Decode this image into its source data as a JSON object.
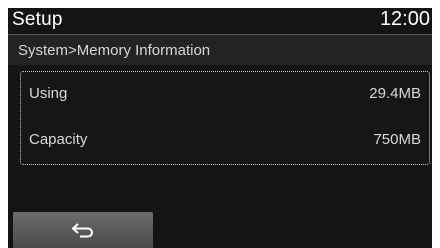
{
  "header": {
    "title": "Setup",
    "clock": "12:00"
  },
  "breadcrumb": "System>Memory Information",
  "memory": {
    "rows": [
      {
        "label": "Using",
        "value": "29.4MB"
      },
      {
        "label": "Capacity",
        "value": "750MB"
      }
    ]
  },
  "footer": {
    "back_icon": "back-arrow-icon"
  },
  "colors": {
    "screen_bg": "#141414",
    "panel_border": "#cfcfcf",
    "button_bg": "#5a5a5a",
    "text": "#ffffff"
  }
}
